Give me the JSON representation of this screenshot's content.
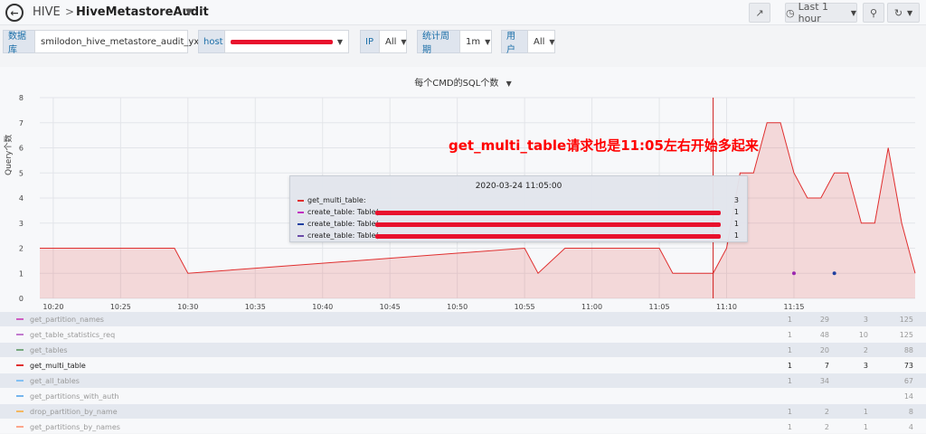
{
  "header": {
    "back_icon": "arrow-left-icon",
    "crumb_folder": "HIVE",
    "crumb_separator": ">",
    "dashboard_title": "HiveMetastoreAudit",
    "time_range": "Last 1 hour",
    "share_icon": "share-icon",
    "clock_icon": "clock-icon",
    "zoom_icon": "search-icon",
    "refresh_icon": "refresh-icon"
  },
  "variables": {
    "database_label": "数据库",
    "database_value": "smilodon_hive_metastore_audit_yx",
    "host_label": "host",
    "ip_label": "IP",
    "ip_value": "All",
    "period_label": "统计周期",
    "period_value": "1m",
    "user_label": "用户",
    "user_value": "All"
  },
  "panel": {
    "title": "每个CMD的SQL个数",
    "ylabel": "Query个数",
    "annotation": "get_multi_table请求也是11:05左右开始多起来"
  },
  "tooltip": {
    "time": "2020-03-24 11:05:00",
    "rows": [
      {
        "name": "get_multi_table:",
        "value": "3",
        "color": "#e02f2f",
        "redacted": false
      },
      {
        "name": "create_table: Table(",
        "value": "1",
        "color": "#c030c0",
        "redacted": true
      },
      {
        "name": "create_table: Table(",
        "value": "1",
        "color": "#1f3fa0",
        "redacted": true
      },
      {
        "name": "create_table: Table(",
        "value": "1",
        "color": "#6a4aa8",
        "redacted": true
      }
    ]
  },
  "chart_data": {
    "type": "area",
    "x_ticks": [
      "10:20",
      "10:25",
      "10:30",
      "10:35",
      "10:40",
      "10:45",
      "10:50",
      "10:55",
      "11:00",
      "11:05",
      "11:10",
      "11:15"
    ],
    "y_ticks": [
      "0",
      "1",
      "2",
      "3",
      "4",
      "5",
      "6",
      "7",
      "8"
    ],
    "ylim": [
      0,
      8
    ],
    "xlim_minutes": [
      -1,
      62
    ],
    "grid": true,
    "series": [
      {
        "name": "get_multi_table",
        "color": "#e02f2f",
        "points": [
          [
            -1,
            2
          ],
          [
            9,
            2
          ],
          [
            10,
            1
          ],
          [
            35,
            2
          ],
          [
            36,
            1
          ],
          [
            38,
            2
          ],
          [
            45,
            2
          ],
          [
            46,
            1
          ],
          [
            49,
            1
          ],
          [
            50,
            2
          ],
          [
            51,
            5
          ],
          [
            52,
            5
          ],
          [
            53,
            7
          ],
          [
            54,
            7
          ],
          [
            55,
            5
          ],
          [
            56,
            4
          ],
          [
            57,
            4
          ],
          [
            58,
            5
          ],
          [
            59,
            5
          ],
          [
            60,
            3
          ],
          [
            61,
            3
          ],
          [
            62,
            6
          ],
          [
            63,
            3
          ],
          [
            64,
            1
          ]
        ]
      }
    ],
    "marker_points": [
      {
        "x": 55,
        "y": 1,
        "color": "#9c27b0"
      },
      {
        "x": 58,
        "y": 1,
        "color": "#1f3fa0"
      }
    ],
    "crosshair_minute": 49
  },
  "legend": {
    "rows": [
      {
        "name": "get_partition_names",
        "color": "#c000a0",
        "c1": "1",
        "c2": "29",
        "c3": "3",
        "c4": "125",
        "alt": true,
        "highlight": false
      },
      {
        "name": "get_table_statistics_req",
        "color": "#9c27b0",
        "c1": "1",
        "c2": "48",
        "c3": "10",
        "c4": "125",
        "alt": false,
        "highlight": false
      },
      {
        "name": "get_tables",
        "color": "#2e7d32",
        "c1": "1",
        "c2": "20",
        "c3": "2",
        "c4": "88",
        "alt": true,
        "highlight": false
      },
      {
        "name": "get_multi_table",
        "color": "#e02f2f",
        "c1": "1",
        "c2": "7",
        "c3": "3",
        "c4": "73",
        "alt": false,
        "highlight": true
      },
      {
        "name": "get_all_tables",
        "color": "#42a5f5",
        "c1": "1",
        "c2": "34",
        "c3": "",
        "c4": "67",
        "alt": true,
        "highlight": false
      },
      {
        "name": "get_partitions_with_auth",
        "color": "#1e88e5",
        "c1": "",
        "c2": "",
        "c3": "",
        "c4": "14",
        "alt": false,
        "highlight": false
      },
      {
        "name": "drop_partition_by_name",
        "color": "#ff9800",
        "c1": "1",
        "c2": "2",
        "c3": "1",
        "c4": "8",
        "alt": true,
        "highlight": false
      },
      {
        "name": "get_partitions_by_names",
        "color": "#ff7043",
        "c1": "1",
        "c2": "2",
        "c3": "1",
        "c4": "4",
        "alt": false,
        "highlight": false
      }
    ]
  }
}
